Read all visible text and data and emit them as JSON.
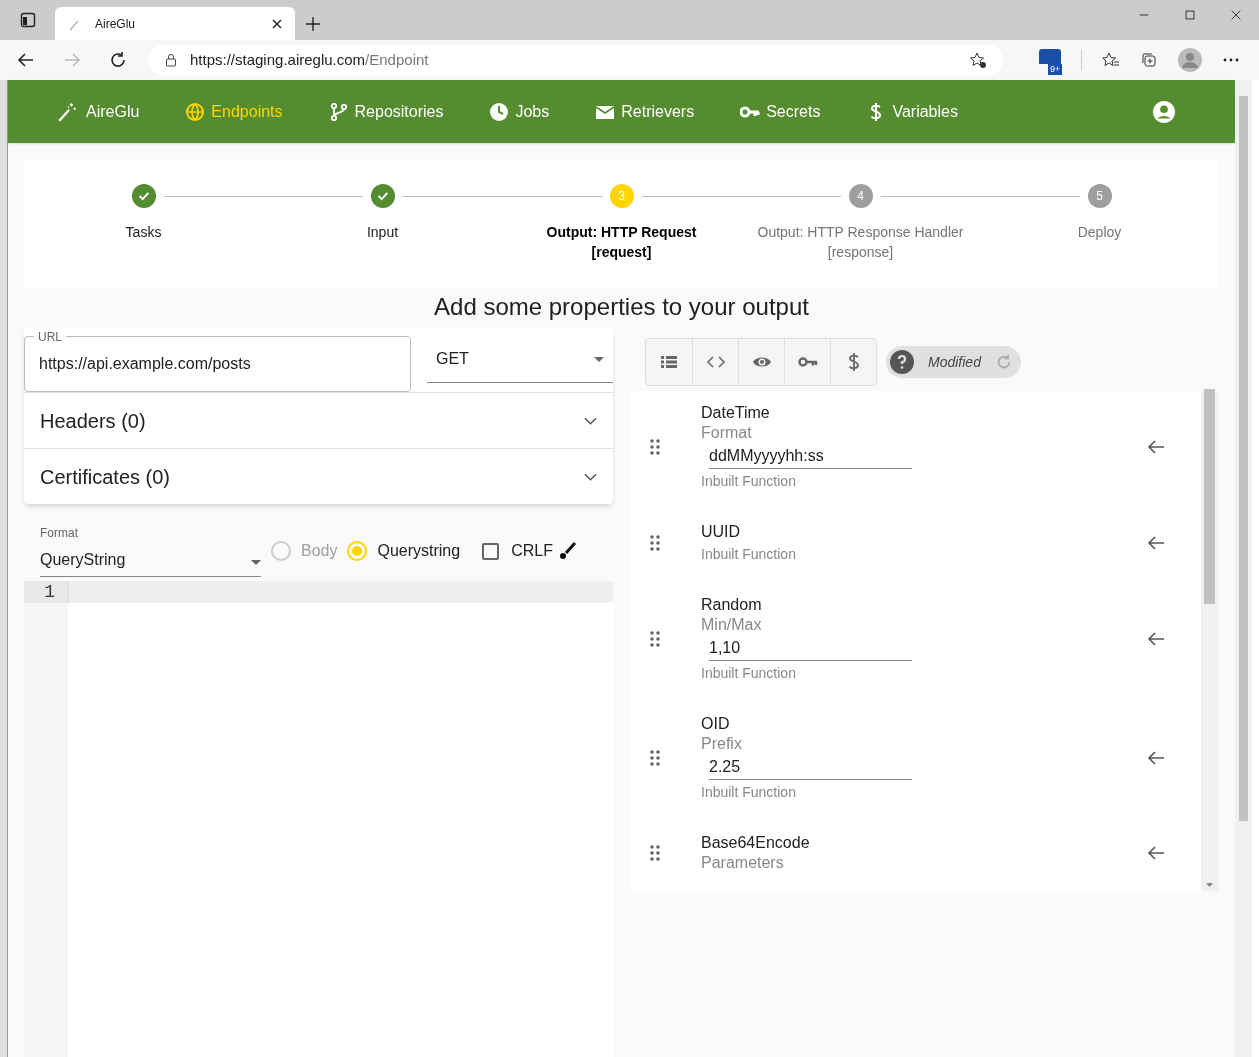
{
  "browser": {
    "tab_title": "AireGlu",
    "url_host": "https://staging.aireglu.com",
    "url_path": "/Endpoint",
    "extensions_badge": "9+"
  },
  "nav": {
    "brand": "AireGlu",
    "items": [
      {
        "label": "Endpoints",
        "selected": true
      },
      {
        "label": "Repositories",
        "selected": false
      },
      {
        "label": "Jobs",
        "selected": false
      },
      {
        "label": "Retrievers",
        "selected": false
      },
      {
        "label": "Secrets",
        "selected": false
      },
      {
        "label": "Variables",
        "selected": false
      }
    ]
  },
  "steps": [
    {
      "label": "Tasks",
      "completed": true,
      "active": false
    },
    {
      "label": "Input",
      "completed": true,
      "active": false
    },
    {
      "number": "3",
      "label": "Output: HTTP Request",
      "sublabel": "[request]",
      "completed": false,
      "active": true
    },
    {
      "number": "4",
      "label": "Output: HTTP Response Handler",
      "sublabel": "[response]",
      "completed": false,
      "active": false
    },
    {
      "number": "5",
      "label": "Deploy",
      "completed": false,
      "active": false
    }
  ],
  "heading": "Add some properties to your output",
  "request": {
    "url_label": "URL",
    "url_value": "https://api.example.com/posts",
    "method": "GET",
    "panels": [
      {
        "title": "Headers (0)",
        "expanded": false
      },
      {
        "title": "Certificates (0)",
        "expanded": false
      }
    ],
    "format_label": "Format",
    "format_value": "QueryString",
    "radios": [
      {
        "label": "Body",
        "selected": false,
        "disabled": true
      },
      {
        "label": "Querystring",
        "selected": true,
        "disabled": false
      }
    ],
    "crlf": {
      "label": "CRLF",
      "checked": false
    },
    "editor_line": "1"
  },
  "toolbar": {
    "status": "Modified"
  },
  "properties": [
    {
      "name": "DateTime",
      "param": "Format",
      "value": "ddMMyyyyhh:ss",
      "note": "Inbuilt Function"
    },
    {
      "name": "UUID",
      "note": "Inbuilt Function"
    },
    {
      "name": "Random",
      "param": "Min/Max",
      "value": "1,10",
      "note": "Inbuilt Function"
    },
    {
      "name": "OID",
      "param": "Prefix",
      "value": "2.25",
      "note": "Inbuilt Function"
    },
    {
      "name": "Base64Encode",
      "param": "Parameters"
    }
  ]
}
